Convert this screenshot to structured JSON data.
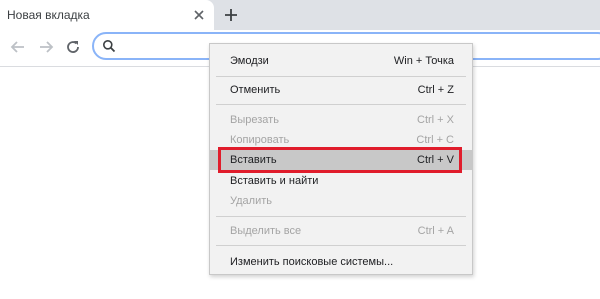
{
  "browser": {
    "tab": {
      "title": "Новая вкладка",
      "close_icon": "close-icon"
    },
    "new_tab_icon": "plus-icon",
    "nav": {
      "back_icon": "arrow-left-icon",
      "forward_icon": "arrow-right-icon",
      "reload_icon": "reload-icon"
    },
    "omnibox": {
      "value": "",
      "search_icon": "search-icon"
    }
  },
  "context_menu": {
    "items": [
      {
        "label": "Эмодзи",
        "shortcut": "Win + Точка",
        "enabled": true
      },
      {
        "label": "Отменить",
        "shortcut": "Ctrl + Z",
        "enabled": true
      },
      {
        "label": "Вырезать",
        "shortcut": "Ctrl + X",
        "enabled": false
      },
      {
        "label": "Копировать",
        "shortcut": "Ctrl + C",
        "enabled": false
      },
      {
        "label": "Вставить",
        "shortcut": "Ctrl + V",
        "enabled": true,
        "highlighted": true
      },
      {
        "label": "Вставить и найти",
        "shortcut": "",
        "enabled": true
      },
      {
        "label": "Удалить",
        "shortcut": "",
        "enabled": false
      },
      {
        "label": "Выделить все",
        "shortcut": "Ctrl + A",
        "enabled": false
      },
      {
        "label": "Изменить поисковые системы...",
        "shortcut": "",
        "enabled": true
      }
    ]
  },
  "colors": {
    "tabstrip": "#dee1e6",
    "menu_background": "#f2f2f2",
    "highlight": "#c8c8c8",
    "annotation_box": "#e01c2b"
  }
}
